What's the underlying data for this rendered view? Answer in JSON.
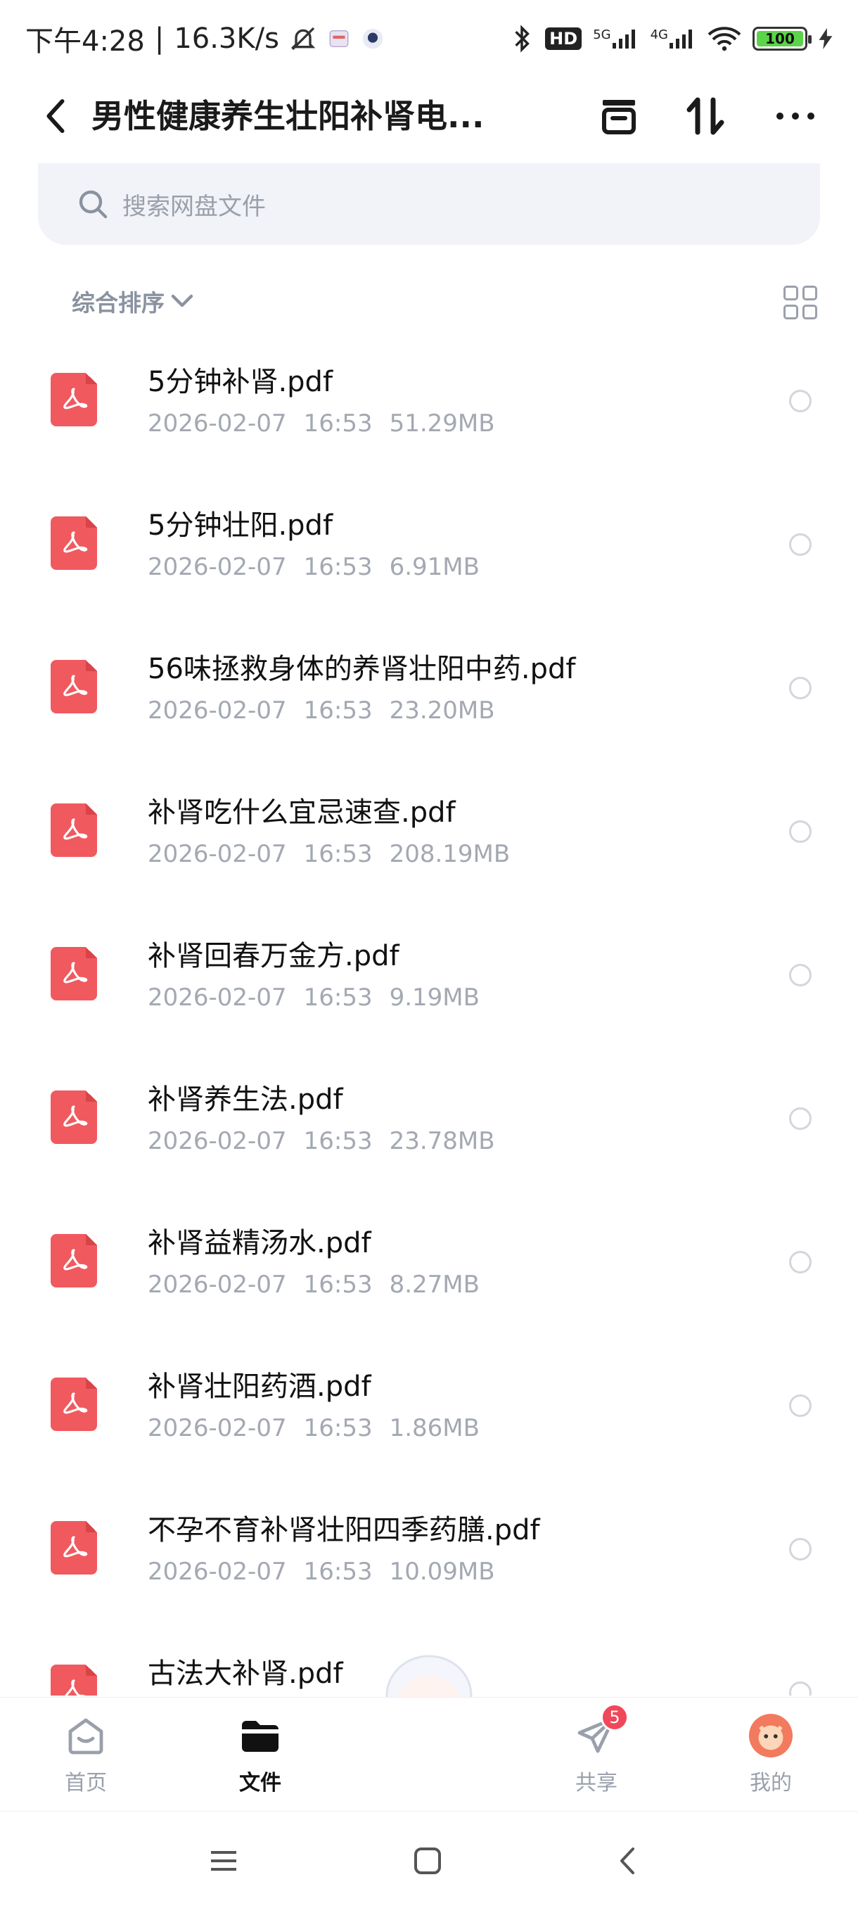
{
  "status_bar": {
    "time": "下午4:28",
    "separator": "|",
    "net_speed": "16.3K/s",
    "hd_label": "HD",
    "signal_5g": "5G",
    "signal_4g": "4G",
    "battery": "100"
  },
  "header": {
    "title": "男性健康养生壮阳补肾电..."
  },
  "search": {
    "placeholder": "搜索网盘文件"
  },
  "sort": {
    "label": "综合排序"
  },
  "files": [
    {
      "name": "5分钟补肾.pdf",
      "date": "2026-02-07",
      "time": "16:53",
      "size": "51.29MB"
    },
    {
      "name": "5分钟壮阳.pdf",
      "date": "2026-02-07",
      "time": "16:53",
      "size": "6.91MB"
    },
    {
      "name": "56味拯救身体的养肾壮阳中药.pdf",
      "date": "2026-02-07",
      "time": "16:53",
      "size": "23.20MB"
    },
    {
      "name": "补肾吃什么宜忌速查.pdf",
      "date": "2026-02-07",
      "time": "16:53",
      "size": "208.19MB"
    },
    {
      "name": "补肾回春万金方.pdf",
      "date": "2026-02-07",
      "time": "16:53",
      "size": "9.19MB"
    },
    {
      "name": "补肾养生法.pdf",
      "date": "2026-02-07",
      "time": "16:53",
      "size": "23.78MB"
    },
    {
      "name": "补肾益精汤水.pdf",
      "date": "2026-02-07",
      "time": "16:53",
      "size": "8.27MB"
    },
    {
      "name": "补肾壮阳药酒.pdf",
      "date": "2026-02-07",
      "time": "16:53",
      "size": "1.86MB"
    },
    {
      "name": "不孕不育补肾壮阳四季药膳.pdf",
      "date": "2026-02-07",
      "time": "16:53",
      "size": "10.09MB"
    },
    {
      "name": "古法大补肾.pdf",
      "date": "",
      "time": "",
      "size": ""
    }
  ],
  "tabs": {
    "home": "首页",
    "files": "文件",
    "share": "共享",
    "share_badge": "5",
    "mine": "我的"
  },
  "colors": {
    "pdf_red": "#f0595e",
    "badge_red": "#f0475a",
    "meta_gray": "#a3a8b2",
    "search_bg": "#f1f3f8"
  },
  "icons": [
    "back-arrow-icon",
    "archive-box-icon",
    "sort-arrows-icon",
    "more-dots-icon",
    "search-icon",
    "chevron-down-icon",
    "grid-view-icon",
    "pdf-file-icon",
    "home-icon",
    "folder-icon",
    "share-paper-plane-icon",
    "avatar-icon"
  ]
}
